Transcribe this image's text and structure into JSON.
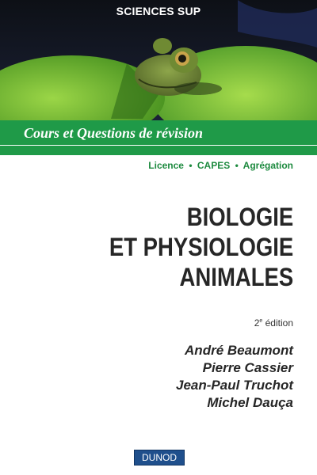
{
  "cover": {
    "series": "SCIENCES SUP",
    "collection": "Cours et Questions de révision",
    "levels": [
      "Licence",
      "CAPES",
      "Agrégation"
    ],
    "level_separator": "•",
    "title_lines": [
      "BIOLOGIE",
      "ET PHYSIOLOGIE",
      "ANIMALES"
    ],
    "edition_number": "2",
    "edition_suffix": "e",
    "edition_word": "édition",
    "authors": [
      "André Beaumont",
      "Pierre Cassier",
      "Jean-Paul Truchot",
      "Michel Dauça"
    ],
    "publisher": "DUNOD",
    "colors": {
      "green_band": "#1f9a48",
      "level_text": "#1d8a3f",
      "title_text": "#262626",
      "publisher_box": "#1f4f8c"
    },
    "illustration": "frog-on-lily-pad-photo"
  }
}
